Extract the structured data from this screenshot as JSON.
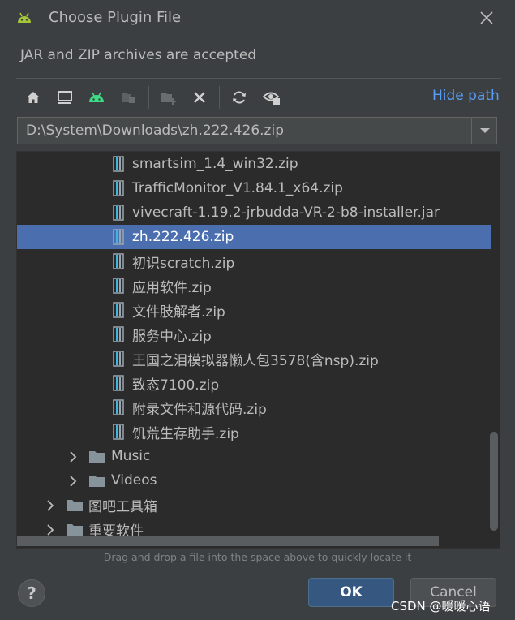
{
  "dialog": {
    "title": "Choose Plugin File",
    "subtitle": "JAR and ZIP archives are accepted",
    "app_icon": "android-icon",
    "close_icon": "close-icon"
  },
  "toolbar": {
    "buttons": [
      {
        "name": "home-icon"
      },
      {
        "name": "desktop-icon"
      },
      {
        "name": "android-project-icon"
      },
      {
        "name": "module-icon"
      },
      {
        "name": "new-folder-icon"
      },
      {
        "name": "delete-icon"
      },
      {
        "name": "refresh-icon"
      },
      {
        "name": "show-hidden-icon"
      }
    ],
    "hide_path_label": "Hide path"
  },
  "path": {
    "value": "D:\\System\\Downloads\\zh.222.426.zip"
  },
  "tree": {
    "items": [
      {
        "label": "smartsim_1.4_win32.zip",
        "type": "zip",
        "level": 3
      },
      {
        "label": "TrafficMonitor_V1.84.1_x64.zip",
        "type": "zip",
        "level": 3
      },
      {
        "label": "vivecraft-1.19.2-jrbudda-VR-2-b8-installer.jar",
        "type": "zip",
        "level": 3
      },
      {
        "label": "zh.222.426.zip",
        "type": "zip",
        "level": 3,
        "selected": true
      },
      {
        "label": "初识scratch.zip",
        "type": "zip",
        "level": 3
      },
      {
        "label": "应用软件.zip",
        "type": "zip",
        "level": 3
      },
      {
        "label": "文件肢解者.zip",
        "type": "zip",
        "level": 3
      },
      {
        "label": "服务中心.zip",
        "type": "zip",
        "level": 3
      },
      {
        "label": "王国之泪模拟器懒人包3578(含nsp).zip",
        "type": "zip",
        "level": 3
      },
      {
        "label": "致态7100.zip",
        "type": "zip",
        "level": 3
      },
      {
        "label": "附录文件和源代码.zip",
        "type": "zip",
        "level": 3
      },
      {
        "label": "饥荒生存助手.zip",
        "type": "zip",
        "level": 3
      },
      {
        "label": "Music",
        "type": "folder",
        "level": 2
      },
      {
        "label": "Videos",
        "type": "folder",
        "level": 2
      },
      {
        "label": "图吧工具箱",
        "type": "folder",
        "level": 1
      },
      {
        "label": "重要软件",
        "type": "folder",
        "level": 1
      }
    ],
    "hint": "Drag and drop a file into the space above to quickly locate it"
  },
  "footer": {
    "help_label": "?",
    "ok_label": "OK",
    "cancel_label": "Cancel",
    "watermark": "CSDN @暖暖心语"
  },
  "colors": {
    "background": "#3c3f41",
    "tree_background": "#2b2b2b",
    "selection": "#4b6eaf",
    "link": "#589df6",
    "ok_button": "#365880",
    "android_green": "#3ddc84"
  }
}
